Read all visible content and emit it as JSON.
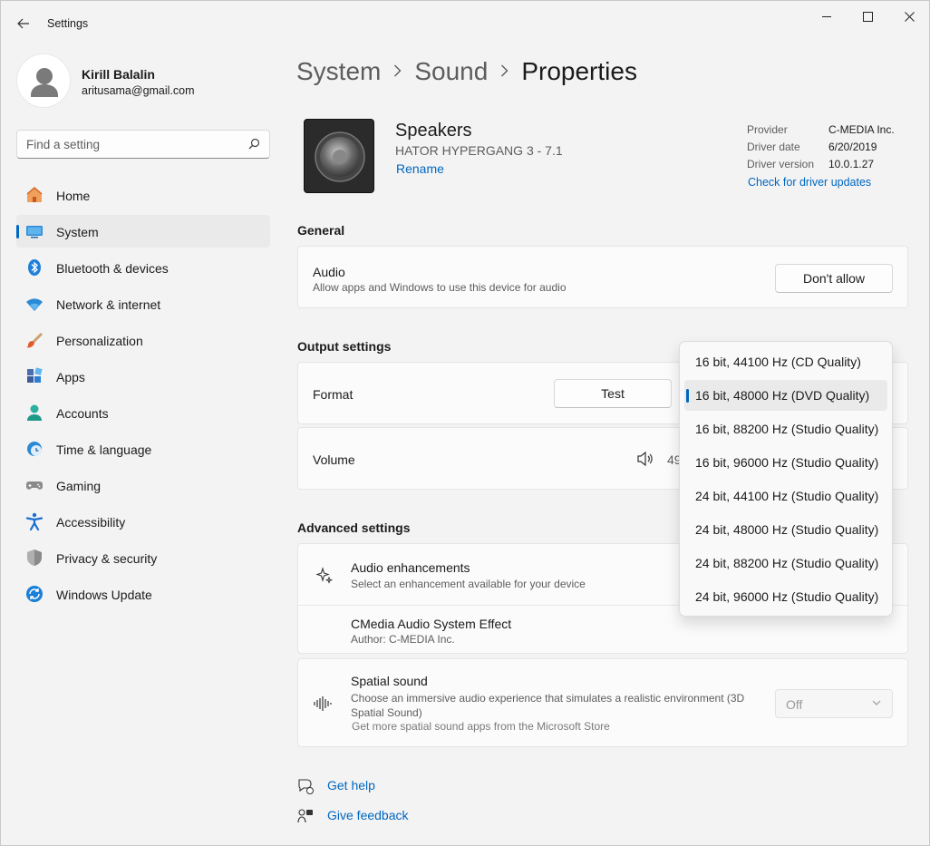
{
  "app": {
    "title": "Settings"
  },
  "user": {
    "name": "Kirill Balalin",
    "email": "aritusama@gmail.com"
  },
  "search": {
    "placeholder": "Find a setting"
  },
  "sidebar": {
    "items": [
      {
        "label": "Home",
        "icon": "home-icon"
      },
      {
        "label": "System",
        "icon": "system-icon",
        "active": true
      },
      {
        "label": "Bluetooth & devices",
        "icon": "bluetooth-icon"
      },
      {
        "label": "Network & internet",
        "icon": "network-icon"
      },
      {
        "label": "Personalization",
        "icon": "personalization-icon"
      },
      {
        "label": "Apps",
        "icon": "apps-icon"
      },
      {
        "label": "Accounts",
        "icon": "accounts-icon"
      },
      {
        "label": "Time & language",
        "icon": "time-language-icon"
      },
      {
        "label": "Gaming",
        "icon": "gaming-icon"
      },
      {
        "label": "Accessibility",
        "icon": "accessibility-icon"
      },
      {
        "label": "Privacy & security",
        "icon": "privacy-security-icon"
      },
      {
        "label": "Windows Update",
        "icon": "windows-update-icon"
      }
    ]
  },
  "breadcrumb": {
    "items": [
      "System",
      "Sound"
    ],
    "current": "Properties"
  },
  "device": {
    "name": "Speakers",
    "model": "HATOR HYPERGANG 3 - 7.1",
    "rename": "Rename"
  },
  "driver": {
    "provider_label": "Provider",
    "provider": "C-MEDIA Inc.",
    "date_label": "Driver date",
    "date": "6/20/2019",
    "version_label": "Driver version",
    "version": "10.0.1.27",
    "check_link": "Check for driver updates"
  },
  "general": {
    "title": "General",
    "audio": {
      "title": "Audio",
      "desc": "Allow apps and Windows to use this device for audio",
      "button": "Don't allow"
    }
  },
  "output": {
    "title": "Output settings",
    "format": {
      "title": "Format",
      "test_button": "Test"
    },
    "volume": {
      "title": "Volume",
      "value": "49"
    }
  },
  "advanced": {
    "title": "Advanced settings",
    "enhancements": {
      "title": "Audio enhancements",
      "desc": "Select an enhancement available for your device"
    },
    "effect": {
      "title": "CMedia Audio System Effect",
      "desc": "Author: C-MEDIA Inc."
    },
    "spatial": {
      "title": "Spatial sound",
      "desc": "Choose an immersive audio experience that simulates a realistic environment (3D Spatial Sound)",
      "link": "Get more spatial sound apps from the Microsoft Store",
      "value": "Off"
    }
  },
  "footer": {
    "help": "Get help",
    "feedback": "Give feedback"
  },
  "format_dropdown": {
    "selected_index": 1,
    "options": [
      "16 bit, 44100 Hz (CD Quality)",
      "16 bit, 48000 Hz (DVD Quality)",
      "16 bit, 88200 Hz (Studio Quality)",
      "16 bit, 96000 Hz (Studio Quality)",
      "24 bit, 44100 Hz (Studio Quality)",
      "24 bit, 48000 Hz (Studio Quality)",
      "24 bit, 88200 Hz (Studio Quality)",
      "24 bit, 96000 Hz (Studio Quality)"
    ]
  },
  "colors": {
    "accent": "#0067c0",
    "background": "#f3f3f3",
    "card": "#fbfbfb"
  }
}
